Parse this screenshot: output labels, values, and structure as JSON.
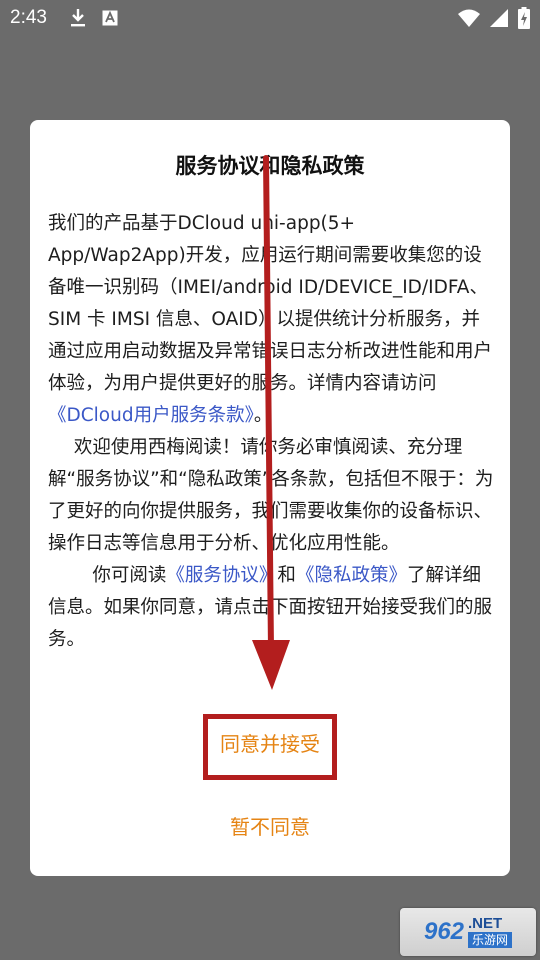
{
  "status_bar": {
    "time": "2:43",
    "left_icons": [
      "download-icon",
      "text-notification-icon"
    ],
    "right_icons": [
      "wifi-icon",
      "signal-icon",
      "battery-charging-icon"
    ]
  },
  "dialog": {
    "title": "服务协议和隐私政策",
    "paragraph1": {
      "text": "我们的产品基于DCloud uni-app(5+ App/Wap2App)开发，应用运行期间需要收集您的设备唯一识别码（IMEI/android ID/DEVICE_ID/IDFA、SIM 卡 IMSI 信息、OAID）以提供统计分析服务，并通过应用启动数据及异常错误日志分析改进性能和用户体验，为用户提供更好的服务。详情内容请访问",
      "link": "《DCloud用户服务条款》",
      "end": "。"
    },
    "paragraph2": "欢迎使用西梅阅读！请你务必审慎阅读、充分理解“服务协议”和“隐私政策”各条款，包括但不限于：为了更好的向你提供服务，我们需要收集你的设备标识、操作日志等信息用于分析、优化应用性能。",
    "paragraph3": {
      "prefix": "你可阅读",
      "link1": "《服务协议》",
      "middle": "和",
      "link2": "《隐私政策》",
      "suffix": "了解详细信息。如果你同意，请点击下面按钮开始接受我们的服务。"
    },
    "agree_label": "同意并接受",
    "decline_label": "暂不同意"
  },
  "colors": {
    "accent": "#e58414",
    "link": "#3b58c7",
    "annotation": "#b31e1e",
    "overlay": "#6b6b6b"
  },
  "watermark": {
    "digits": "962",
    "suffix": ".NET",
    "site_name": "乐游网"
  }
}
